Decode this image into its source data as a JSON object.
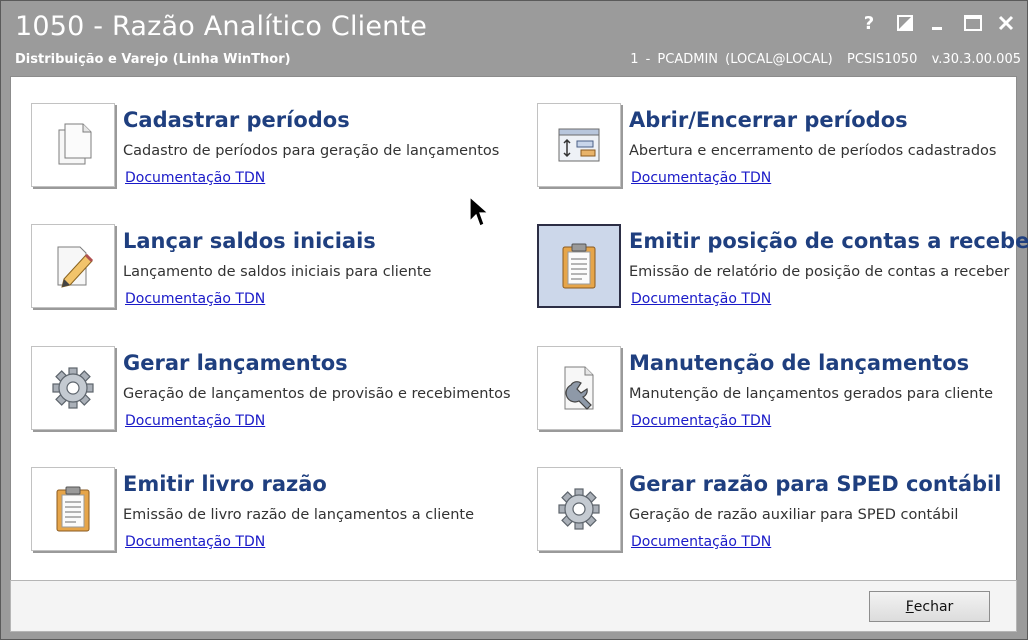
{
  "window": {
    "title": "1050 - Razão Analítico Cliente",
    "subtitle": "Distribuição e Varejo (Linha WinThor)",
    "user_info": "1 - PCADMIN (LOCAL@LOCAL)  PCSIS1050  v.30.3.00.005",
    "controls": [
      {
        "icon": "help-icon",
        "glyph": "?"
      },
      {
        "icon": "restore-panel-icon",
        "glyph": "◪"
      },
      {
        "icon": "minimize-icon",
        "glyph": "_"
      },
      {
        "icon": "maximize-icon",
        "glyph": "☐"
      },
      {
        "icon": "close-icon",
        "glyph": "✕"
      }
    ]
  },
  "items": [
    {
      "title": "Cadastrar períodos",
      "description": "Cadastro de períodos para geração de lançamentos",
      "link": "Documentação TDN",
      "icon": "documents-icon"
    },
    {
      "title": "Abrir/Encerrar períodos",
      "description": "Abertura e encerramento de períodos cadastrados",
      "link": "Documentação TDN",
      "icon": "period-window-icon"
    },
    {
      "title": "Lançar saldos iniciais",
      "description": "Lançamento de saldos iniciais para cliente",
      "link": "Documentação TDN",
      "icon": "edit-document-icon"
    },
    {
      "title": "Emitir posição de contas a receber",
      "description": "Emissão de relatório de posição de contas a receber",
      "link": "Documentação TDN",
      "icon": "clipboard-icon",
      "selected": true
    },
    {
      "title": "Gerar lançamentos",
      "description": "Geração de lançamentos de provisão e recebimentos",
      "link": "Documentação TDN",
      "icon": "gear-icon"
    },
    {
      "title": "Manutenção de lançamentos",
      "description": "Manutenção de lançamentos gerados para cliente",
      "link": "Documentação TDN",
      "icon": "wrench-document-icon"
    },
    {
      "title": "Emitir livro razão",
      "description": "Emissão de livro razão de lançamentos a cliente",
      "link": "Documentação TDN",
      "icon": "clipboard-icon"
    },
    {
      "title": "Gerar razão para SPED contábil",
      "description": "Geração de razão auxiliar para SPED contábil",
      "link": "Documentação TDN",
      "icon": "gear-icon"
    }
  ],
  "footer": {
    "close_label_accel": "F",
    "close_label_rest": "echar"
  },
  "colors": {
    "title_bar": "#9b9b9b",
    "item_title": "#1f3f7f",
    "link": "#1a1ac8",
    "selected_tile": "#ccd7ea"
  }
}
